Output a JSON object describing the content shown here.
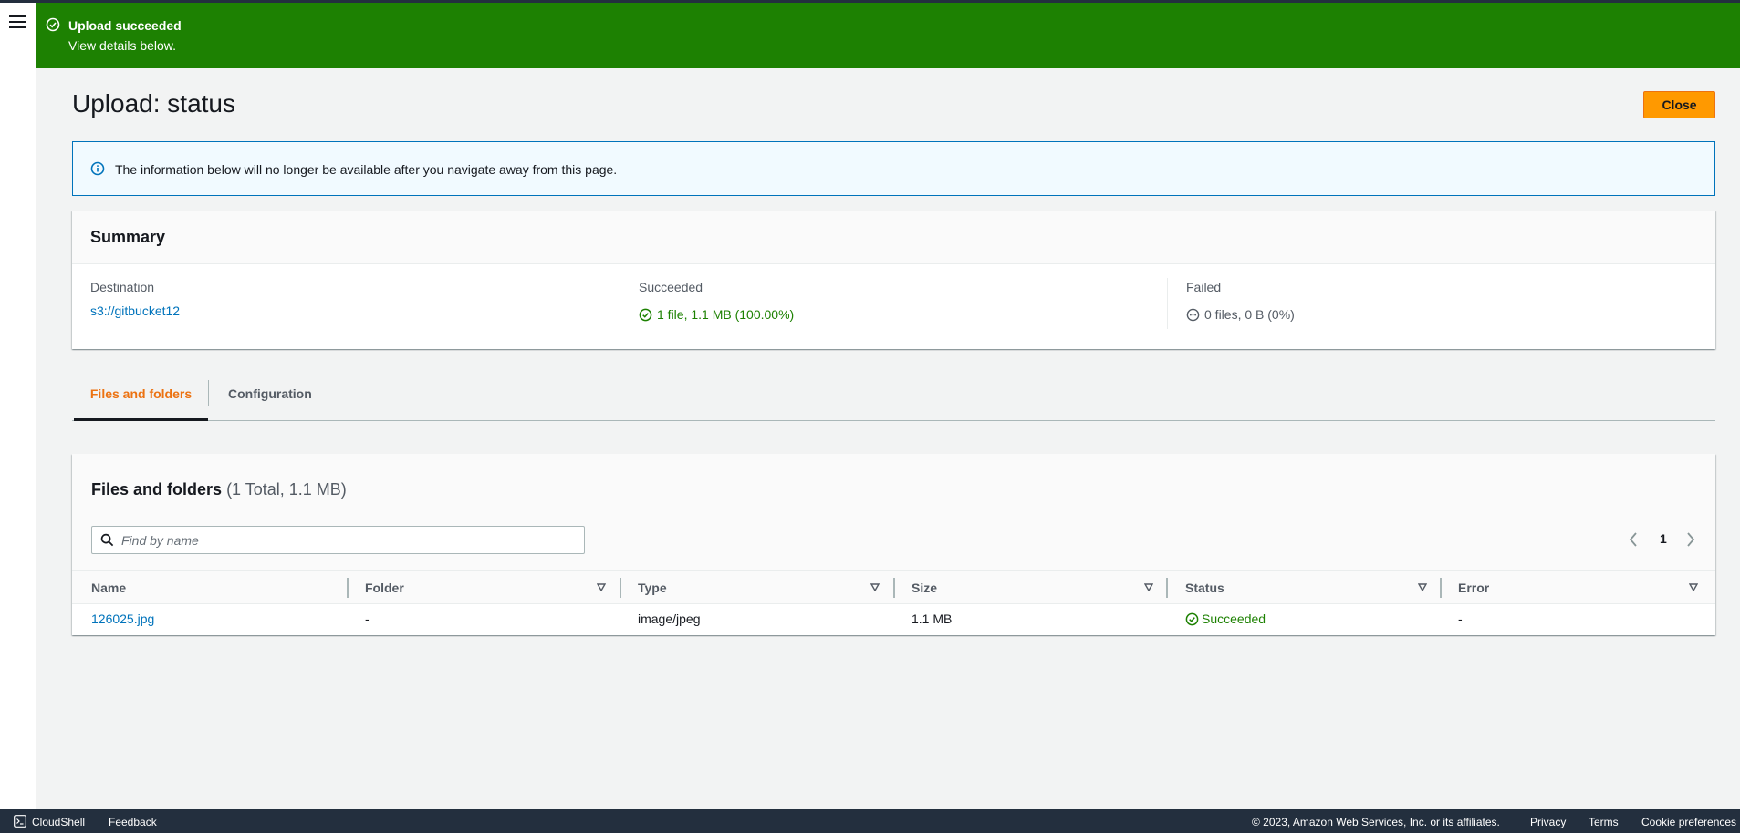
{
  "nav": {
    "menu_icon": "hamburger-menu-icon"
  },
  "flash": {
    "title": "Upload succeeded",
    "description": "View details below.",
    "icon": "success-circle-icon",
    "color": "#1d8102"
  },
  "page": {
    "title": "Upload: status",
    "close_label": "Close"
  },
  "info_alert": {
    "icon": "info-icon",
    "text": "The information below will no longer be available after you navigate away from this page."
  },
  "summary": {
    "title": "Summary",
    "destination": {
      "label": "Destination",
      "value": "s3://gitbucket12"
    },
    "succeeded": {
      "label": "Succeeded",
      "value": "1 file, 1.1 MB (100.00%)",
      "icon": "success-circle-icon"
    },
    "failed": {
      "label": "Failed",
      "value": "0 files, 0 B (0%)",
      "icon": "more-circle-icon"
    }
  },
  "tabs": [
    {
      "label": "Files and folders",
      "active": true
    },
    {
      "label": "Configuration",
      "active": false
    }
  ],
  "files": {
    "title": "Files and folders",
    "count": "(1 Total, 1.1 MB)",
    "search_placeholder": "Find by name",
    "page_number": "1",
    "columns": [
      "Name",
      "Folder",
      "Type",
      "Size",
      "Status",
      "Error"
    ],
    "rows": [
      {
        "name": "126025.jpg",
        "folder": "-",
        "type": "image/jpeg",
        "size": "1.1 MB",
        "status": "Succeeded",
        "error": "-"
      }
    ]
  },
  "footer": {
    "cloudshell": "CloudShell",
    "feedback": "Feedback",
    "copyright": "© 2023, Amazon Web Services, Inc. or its affiliates.",
    "privacy": "Privacy",
    "terms": "Terms",
    "cookies": "Cookie preferences"
  },
  "colors": {
    "accent": "#ec7211",
    "primary_button": "#ff9900",
    "link": "#0073bb",
    "success": "#1d8102",
    "footer_bg": "#232f3e"
  }
}
